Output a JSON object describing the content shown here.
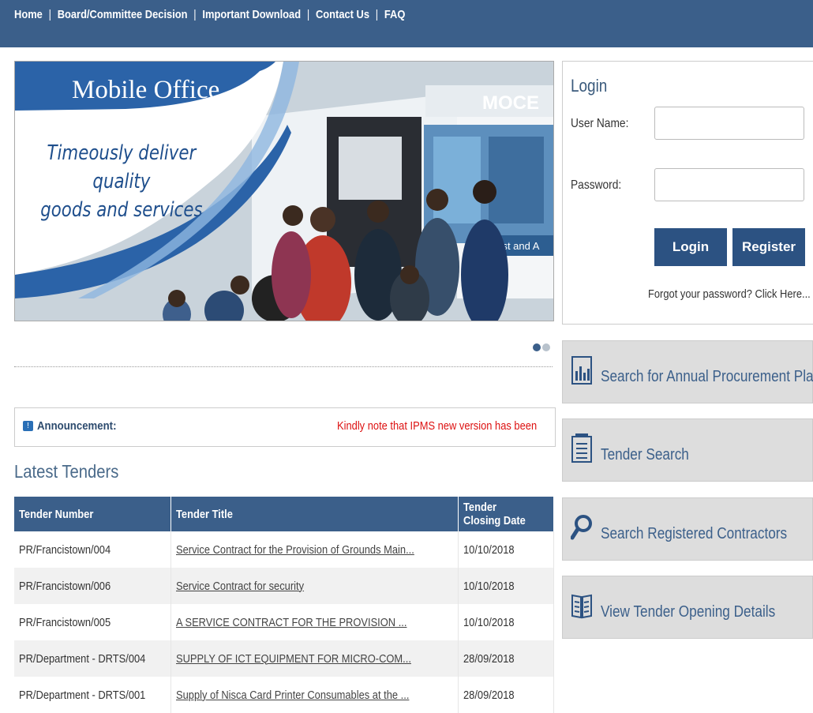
{
  "nav": {
    "home": "Home",
    "board": "Board/Committee Decision",
    "downloads": "Important Download",
    "contact": "Contact Us",
    "faq": "FAQ",
    "sep": "|"
  },
  "banner": {
    "title": "Mobile Office",
    "slogan_line1": "Timeously deliver quality",
    "slogan_line2": "goods and services",
    "van_logo": "MOCE",
    "van_text": "Inclust and A"
  },
  "announcement": {
    "label": "Announcement:",
    "message": "Kindly note that IPMS new version has been"
  },
  "latest": {
    "title": "Latest Tenders",
    "headers": [
      "Tender Number",
      "Tender Title",
      "Tender Closing Date"
    ],
    "rows": [
      {
        "number": "PR/Francistown/004",
        "title": "Service Contract for the Provision of Grounds Main...",
        "date": "10/10/2018"
      },
      {
        "number": "PR/Francistown/006",
        "title": "Service Contract for security",
        "date": "10/10/2018"
      },
      {
        "number": "PR/Francistown/005",
        "title": "A SERVICE CONTRACT FOR THE PROVISION ...",
        "date": "10/10/2018"
      },
      {
        "number": "PR/Department - DRTS/004",
        "title": "SUPPLY OF ICT EQUIPMENT FOR MICRO-COM...",
        "date": "28/09/2018"
      },
      {
        "number": "PR/Department - DRTS/001",
        "title": "Supply of Nisca Card Printer Consumables at the ...",
        "date": "28/09/2018"
      }
    ]
  },
  "login": {
    "title": "Login",
    "username_label": "User Name:",
    "password_label": "Password:",
    "login_btn": "Login",
    "register_btn": "Register",
    "forgot": "Forgot your password? Click Here..."
  },
  "side": {
    "plan": "Search for Annual Procurement Plan",
    "tender_search": "Tender Search",
    "contractors": "Search Registered Contractors",
    "opening": "View Tender Opening Details"
  },
  "colors": {
    "nav_bg": "#3b5f8a",
    "button_bg": "#2c5282",
    "announcement_text": "#d11111"
  }
}
